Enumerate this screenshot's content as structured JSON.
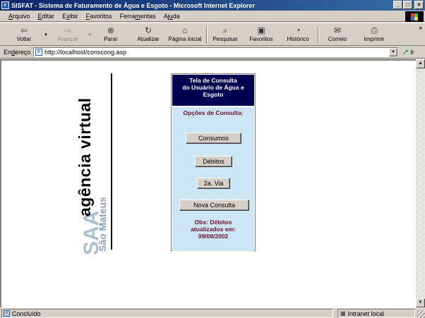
{
  "window": {
    "title": "SISFAT - Sistema de Faturamento de Água e Esgoto - Microsoft Internet Explorer",
    "minimize": "_",
    "maximize": "□",
    "close": "×"
  },
  "menu": {
    "items": [
      {
        "u": "A",
        "rest": "rquivo"
      },
      {
        "u": "E",
        "rest": "ditar"
      },
      {
        "pre": "E",
        "u": "x",
        "rest": "ibir"
      },
      {
        "u": "F",
        "rest": "avoritos"
      },
      {
        "pre": "Ferra",
        "u": "m",
        "rest": "entas"
      },
      {
        "pre": "Aj",
        "u": "u",
        "rest": "da"
      }
    ]
  },
  "toolbar": {
    "back": "Voltar",
    "forward": "Avançar",
    "stop": "Parar",
    "refresh": "Atualizar",
    "home": "Página inicial",
    "search": "Pesquisar",
    "favorites": "Favoritos",
    "history": "Histórico",
    "mail": "Correio",
    "print": "Imprimir",
    "more": "»"
  },
  "address": {
    "label_pre": "En",
    "label_u": "d",
    "label_rest": "ereço",
    "url": "http://localhost/conscong.asp",
    "go": "Ir"
  },
  "logo": {
    "main": "agência virtual",
    "mark": "SAA",
    "sub": "São Mateus"
  },
  "panel": {
    "title_lines": [
      "Tela de Consulta",
      "do Usuário de Água e",
      "Esgoto"
    ],
    "subtitle": "Opções de Consulta:",
    "buttons": {
      "consumos": "Consumos",
      "debitos": "Débitos",
      "segunda_via": "2a. Via",
      "nova_consulta": "Nova Consulta"
    },
    "obs_lines": [
      "Obs: Débitos",
      "atualizados em:",
      "09/08/2002"
    ]
  },
  "status": {
    "text": "Concluído",
    "zone": "Intranet local"
  }
}
